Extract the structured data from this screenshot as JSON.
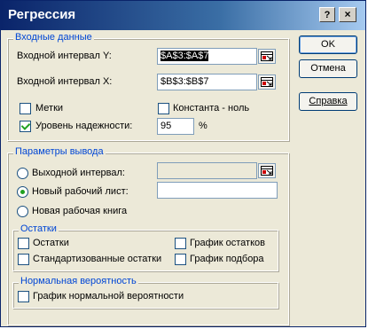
{
  "window": {
    "title": "Регрессия",
    "help_glyph": "?",
    "close_glyph": "×"
  },
  "buttons": {
    "ok": "OK",
    "cancel": "Отмена",
    "help": "Справка"
  },
  "input_group": {
    "label": "Входные данные",
    "y_range_label": "Входной интервал Y:",
    "y_range_value": "$A$3:$A$7",
    "x_range_label": "Входной интервал X:",
    "x_range_value": "$B$3:$B$7",
    "labels_checkbox": "Метки",
    "labels_checked": false,
    "constant_zero_checkbox": "Константа - ноль",
    "constant_zero_checked": false,
    "confidence_checkbox": "Уровень надежности:",
    "confidence_checked": true,
    "confidence_value": "95",
    "confidence_unit": "%"
  },
  "output_group": {
    "label": "Параметры вывода",
    "output_range_label": "Выходной интервал:",
    "output_range_value": "",
    "new_sheet_label": "Новый рабочий лист:",
    "new_sheet_value": "",
    "new_workbook_label": "Новая рабочая книга",
    "selected_option": "new_sheet"
  },
  "residuals_group": {
    "label": "Остатки",
    "residuals": "Остатки",
    "standardized_residuals": "Стандартизованные остатки",
    "residual_plots": "График остатков",
    "line_fit_plots": "График подбора",
    "residuals_checked": false,
    "standardized_checked": false,
    "residual_plots_checked": false,
    "line_fit_checked": false
  },
  "normal_group": {
    "label": "Нормальная вероятность",
    "normal_plot": "График нормальной вероятности",
    "normal_plot_checked": false
  },
  "colors": {
    "accent_label": "#0046d5",
    "title_bar": "#0a246a",
    "dialog_bg": "#ece9d8",
    "check_mark": "#21a121"
  },
  "icons": {
    "range_select": "range-select-icon"
  }
}
